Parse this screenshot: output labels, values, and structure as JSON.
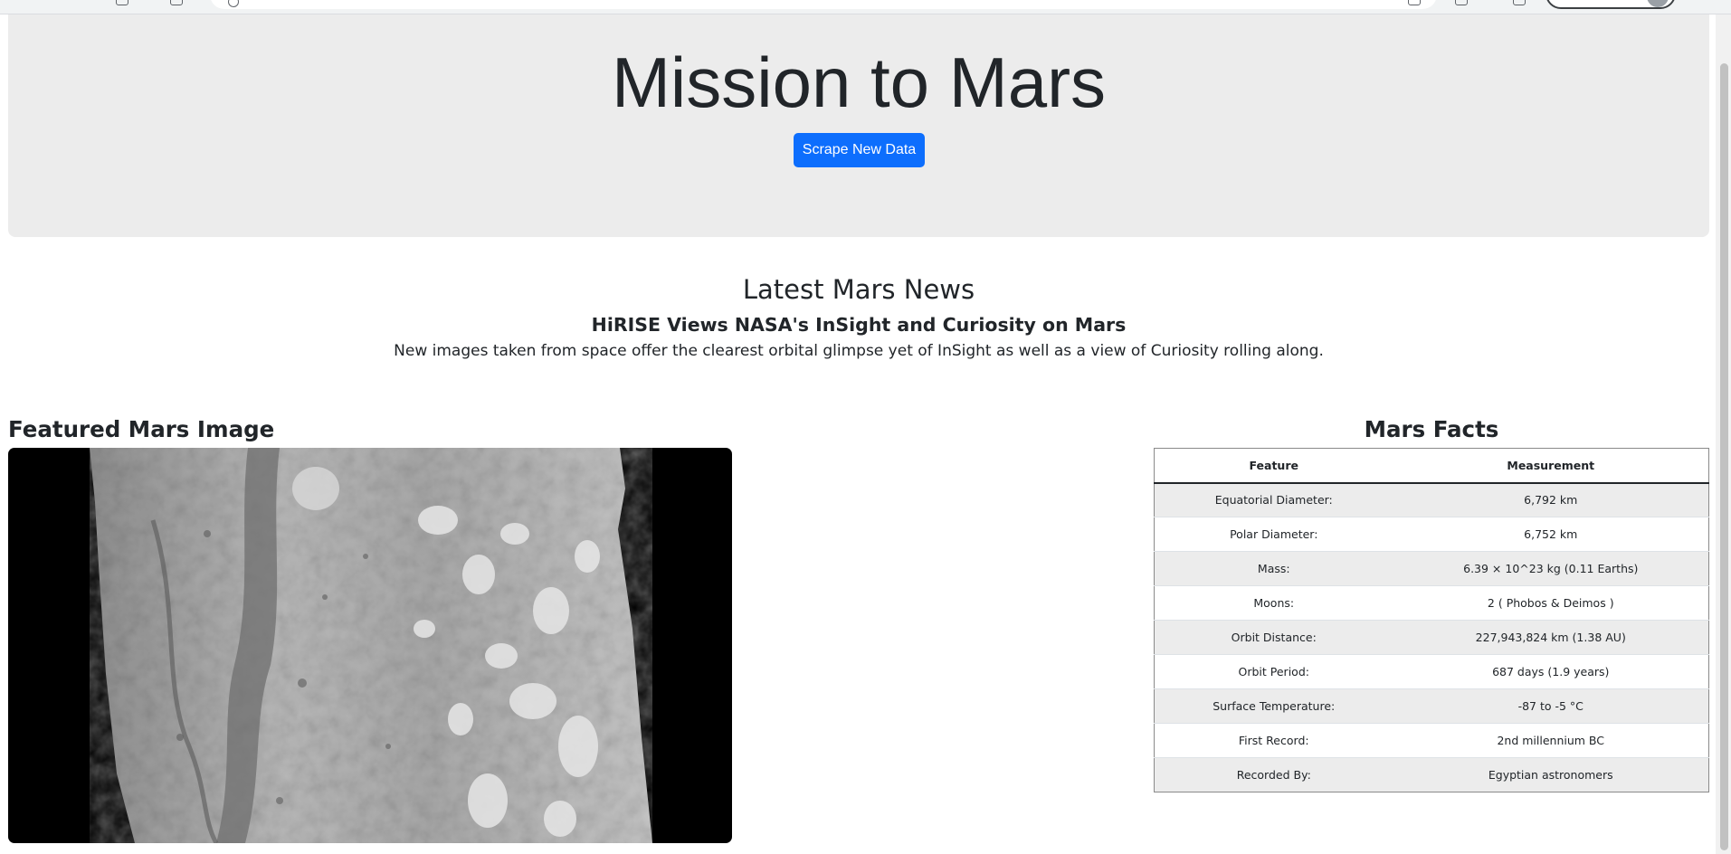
{
  "header": {
    "title": "Mission to Mars",
    "scrape_button": "Scrape New Data"
  },
  "news": {
    "heading": "Latest Mars News",
    "title": "HiRISE Views NASA's InSight and Curiosity on Mars",
    "teaser": "New images taken from space offer the clearest orbital glimpse yet of InSight as well as a view of Curiosity rolling along."
  },
  "featured": {
    "heading": "Featured Mars Image"
  },
  "facts": {
    "heading": "Mars Facts",
    "columns": [
      "Feature",
      "Measurement"
    ],
    "rows": [
      [
        "Equatorial Diameter:",
        "6,792 km"
      ],
      [
        "Polar Diameter:",
        "6,752 km"
      ],
      [
        "Mass:",
        "6.39 × 10^23 kg (0.11 Earths)"
      ],
      [
        "Moons:",
        "2 ( Phobos & Deimos )"
      ],
      [
        "Orbit Distance:",
        "227,943,824 km (1.38 AU)"
      ],
      [
        "Orbit Period:",
        "687 days (1.9 years)"
      ],
      [
        "Surface Temperature:",
        "-87 to -5 °C"
      ],
      [
        "First Record:",
        "2nd millennium BC"
      ],
      [
        "Recorded By:",
        "Egyptian astronomers"
      ]
    ]
  },
  "colors": {
    "primary_button": "#0d6efd",
    "jumbotron_bg": "#ececec",
    "text": "#212529"
  }
}
